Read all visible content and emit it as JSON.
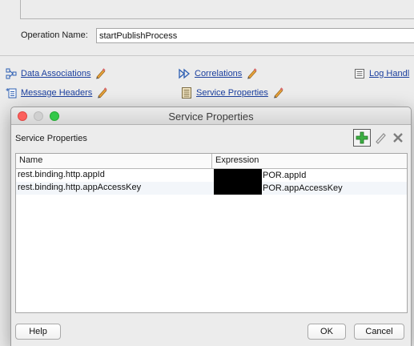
{
  "editor": {
    "operation_label": "Operation Name:",
    "operation_value": "startPublishProcess",
    "links": {
      "data_associations": "Data Associations",
      "correlations": "Correlations",
      "log_handlers": "Log Handl",
      "message_headers": "Message Headers",
      "service_properties": "Service Properties"
    }
  },
  "dialog": {
    "title": "Service Properties",
    "section_label": "Service Properties",
    "columns": [
      "Name",
      "Expression"
    ],
    "rows": [
      {
        "name": "rest.binding.http.appId",
        "expression": "POR.appId"
      },
      {
        "name": "rest.binding.http.appAccessKey",
        "expression": "POR.appAccessKey"
      }
    ],
    "buttons": {
      "help": "Help",
      "ok": "OK",
      "cancel": "Cancel"
    }
  }
}
